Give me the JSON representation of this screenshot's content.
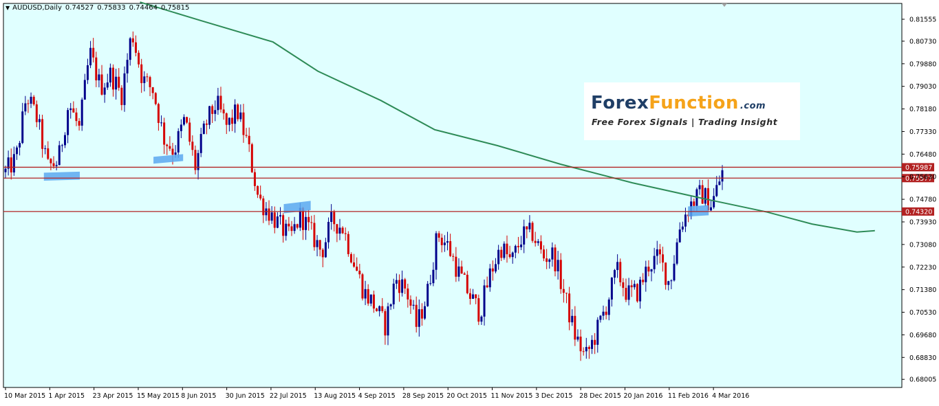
{
  "header": {
    "symbol": "AUDUSD,Daily",
    "open": "0.74527",
    "high": "0.75833",
    "low": "0.74464",
    "close": "0.75815"
  },
  "logo": {
    "part1": "Forex",
    "part2": "Function",
    "suffix": ".com",
    "tagline": "Free Forex Signals | Trading Insight"
  },
  "colors": {
    "background": "#e0ffff",
    "bull_candle": "#00008b",
    "bear_candle": "#d50000",
    "moving_average": "#2e8b57",
    "level_line": "#b22222",
    "highlight": "#5aa8f0",
    "axis_text": "#000000"
  },
  "chart_data": {
    "type": "candlestick",
    "symbol": "AUDUSD",
    "timeframe": "Daily",
    "ylim": [
      0.677,
      0.8215
    ],
    "y_ticks": [
      "0.81555",
      "0.80730",
      "0.79880",
      "0.79030",
      "0.78180",
      "0.77330",
      "0.76480",
      "0.75630",
      "0.74780",
      "0.73930",
      "0.73080",
      "0.72230",
      "0.71380",
      "0.70530",
      "0.69680",
      "0.68830",
      "0.68005"
    ],
    "x_ticks": [
      "10 Mar 2015",
      "1 Apr 2015",
      "23 Apr 2015",
      "15 May 2015",
      "8 Jun 2015",
      "30 Jun 2015",
      "22 Jul 2015",
      "13 Aug 2015",
      "4 Sep 2015",
      "28 Sep 2015",
      "20 Oct 2015",
      "11 Nov 2015",
      "3 Dec 2015",
      "28 Dec 2015",
      "20 Jan 2016",
      "11 Feb 2016",
      "4 Mar 2016"
    ],
    "horizontal_levels": [
      {
        "value": 0.75987,
        "label": "0.75987"
      },
      {
        "value": 0.75577,
        "label": "0.75577"
      },
      {
        "value": 0.7432,
        "label": "0.74320"
      }
    ],
    "price_path": [
      0.758,
      0.763,
      0.787,
      0.778,
      0.76,
      0.762,
      0.784,
      0.774,
      0.803,
      0.79,
      0.795,
      0.787,
      0.811,
      0.793,
      0.789,
      0.771,
      0.766,
      0.778,
      0.76,
      0.776,
      0.784,
      0.775,
      0.781,
      0.768,
      0.748,
      0.743,
      0.738,
      0.733,
      0.742,
      0.735,
      0.728,
      0.74,
      0.737,
      0.725,
      0.713,
      0.708,
      0.7,
      0.718,
      0.714,
      0.7,
      0.712,
      0.735,
      0.73,
      0.72,
      0.712,
      0.705,
      0.72,
      0.73,
      0.724,
      0.734,
      0.735,
      0.726,
      0.727,
      0.712,
      0.697,
      0.688,
      0.697,
      0.708,
      0.721,
      0.712,
      0.713,
      0.723,
      0.726,
      0.716,
      0.738,
      0.746,
      0.75,
      0.746,
      0.758
    ],
    "moving_average": {
      "x": [
        0.152,
        0.22,
        0.3,
        0.35,
        0.42,
        0.48,
        0.55,
        0.62,
        0.7,
        0.78,
        0.85,
        0.9,
        0.95,
        0.97
      ],
      "y": [
        0.822,
        0.815,
        0.807,
        0.796,
        0.785,
        0.774,
        0.768,
        0.761,
        0.754,
        0.748,
        0.743,
        0.7385,
        0.7355,
        0.736
      ]
    },
    "highlight_zones": [
      {
        "x0": 0.045,
        "x1": 0.085,
        "y0": 0.7578,
        "y1": 0.7548,
        "tilt": 0.0004
      },
      {
        "x0": 0.167,
        "x1": 0.2,
        "y0": 0.7638,
        "y1": 0.7612,
        "tilt": 0.001
      },
      {
        "x0": 0.312,
        "x1": 0.342,
        "y0": 0.746,
        "y1": 0.7425,
        "tilt": 0.0012
      },
      {
        "x0": 0.762,
        "x1": 0.785,
        "y0": 0.7451,
        "y1": 0.7413,
        "tilt": 0.0005
      }
    ]
  }
}
